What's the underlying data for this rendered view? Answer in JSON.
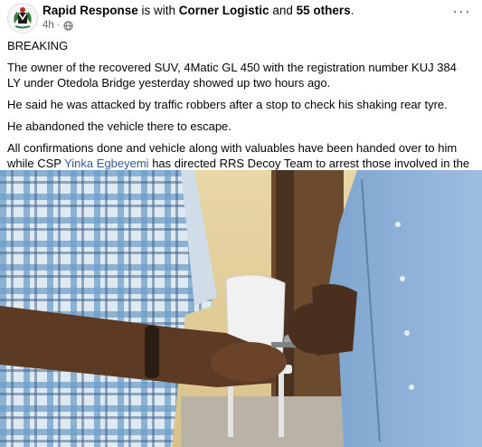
{
  "post": {
    "author": "Rapid Response",
    "with_text": " is with ",
    "tagged_page": "Corner Logistic",
    "and_text": " and ",
    "others": "55 others",
    "period": ".",
    "time": "4h",
    "dot": "·",
    "privacy_icon": "globe-icon",
    "more_icon": "more-options-icon",
    "more_label": "···"
  },
  "content": {
    "breaking": "BREAKING",
    "p1": "The owner of the recovered SUV, 4Matic GL 450 with the registration number KUJ 384 LY under Otedola Bridge yesterday showed up two hours ago.",
    "p2": "He said he was attacked by traffic robbers after a stop to check his shaking rear tyre.",
    "p3": "He abandoned the vehicle there to escape.",
    "p4_before": "All confirmations done and vehicle along with valuables have been handed over to him while CSP ",
    "p4_mention": "Yinka Egbeyemi",
    "p4_after": "  has directed RRS Decoy Team to arrest those involved in the attack."
  },
  "colors": {
    "mention": "#385898",
    "meta": "#65676b"
  }
}
